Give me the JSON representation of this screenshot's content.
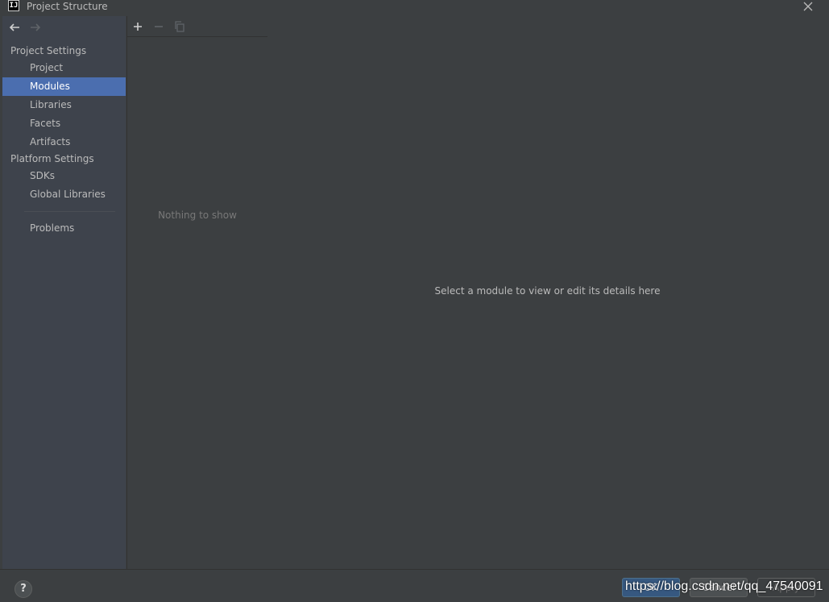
{
  "window": {
    "title": "Project Structure",
    "app_icon_text": "IJ"
  },
  "sidebar": {
    "project_settings_label": "Project Settings",
    "project_items": [
      {
        "label": "Project"
      },
      {
        "label": "Modules",
        "selected": true
      },
      {
        "label": "Libraries"
      },
      {
        "label": "Facets"
      },
      {
        "label": "Artifacts"
      }
    ],
    "platform_settings_label": "Platform Settings",
    "platform_items": [
      {
        "label": "SDKs"
      },
      {
        "label": "Global Libraries"
      }
    ],
    "problems_label": "Problems"
  },
  "modules_panel": {
    "empty_text": "Nothing to show"
  },
  "details_panel": {
    "placeholder": "Select a module to view or edit its details here"
  },
  "buttons": {
    "help": "?",
    "ok": "OK",
    "cancel": "Cancel",
    "apply": "Apply"
  },
  "watermark": "https://blog.csdn.net/qq_47540091",
  "colors": {
    "background": "#3c3f41",
    "sidebar_background": "#3e434c",
    "selection": "#4b6eaf",
    "text": "#bbbbbb",
    "muted_text": "#787878",
    "default_button": "#365880"
  },
  "icons": {
    "app": "intellij-idea-icon",
    "close": "close-icon",
    "back": "back-arrow-icon",
    "forward": "forward-arrow-icon",
    "add": "plus-icon",
    "remove": "minus-icon",
    "copy": "copy-icon",
    "help": "help-icon"
  }
}
